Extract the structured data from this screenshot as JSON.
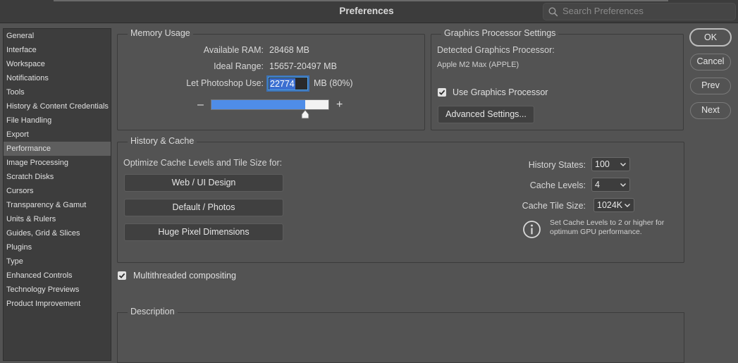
{
  "window": {
    "title": "Preferences"
  },
  "search": {
    "placeholder": "Search Preferences",
    "icon": "search-icon"
  },
  "sidebar": {
    "items": [
      {
        "label": "General"
      },
      {
        "label": "Interface"
      },
      {
        "label": "Workspace"
      },
      {
        "label": "Notifications"
      },
      {
        "label": "Tools"
      },
      {
        "label": "History & Content Credentials"
      },
      {
        "label": "File Handling"
      },
      {
        "label": "Export"
      },
      {
        "label": "Performance",
        "selected": true
      },
      {
        "label": "Image Processing"
      },
      {
        "label": "Scratch Disks"
      },
      {
        "label": "Cursors"
      },
      {
        "label": "Transparency & Gamut"
      },
      {
        "label": "Units & Rulers"
      },
      {
        "label": "Guides, Grid & Slices"
      },
      {
        "label": "Plugins"
      },
      {
        "label": "Type"
      },
      {
        "label": "Enhanced Controls"
      },
      {
        "label": "Technology Previews"
      },
      {
        "label": "Product Improvement"
      }
    ]
  },
  "memory": {
    "title": "Memory Usage",
    "available_label": "Available RAM:",
    "available_value": "28468 MB",
    "ideal_label": "Ideal Range:",
    "ideal_value": "15657-20497 MB",
    "let_label": "Let Photoshop Use:",
    "let_value": "22774",
    "let_suffix": "MB (80%)",
    "slider_fraction": 0.8,
    "minus": "–",
    "plus": "+"
  },
  "gpu": {
    "title": "Graphics Processor Settings",
    "detected_label": "Detected Graphics Processor:",
    "detected_value": "Apple M2 Max (APPLE)",
    "use_label": "Use Graphics Processor",
    "use_checked": true,
    "advanced_label": "Advanced Settings..."
  },
  "cache": {
    "title": "History & Cache",
    "optimize_label": "Optimize Cache Levels and Tile Size for:",
    "buttons": [
      "Web / UI Design",
      "Default / Photos",
      "Huge Pixel Dimensions"
    ],
    "history_label": "History States:",
    "history_value": "100",
    "levels_label": "Cache Levels:",
    "levels_value": "4",
    "tile_label": "Cache Tile Size:",
    "tile_value": "1024K",
    "info_text_1": "Set Cache Levels to 2 or higher for",
    "info_text_2": "optimum GPU performance."
  },
  "multithreaded": {
    "label": "Multithreaded compositing",
    "checked": true
  },
  "description": {
    "title": "Description"
  },
  "actions": {
    "ok": "OK",
    "cancel": "Cancel",
    "prev": "Prev",
    "next": "Next"
  },
  "colors": {
    "accent": "#3b6fd1",
    "slider_fill": "#4f8de8",
    "background": "#535353"
  }
}
